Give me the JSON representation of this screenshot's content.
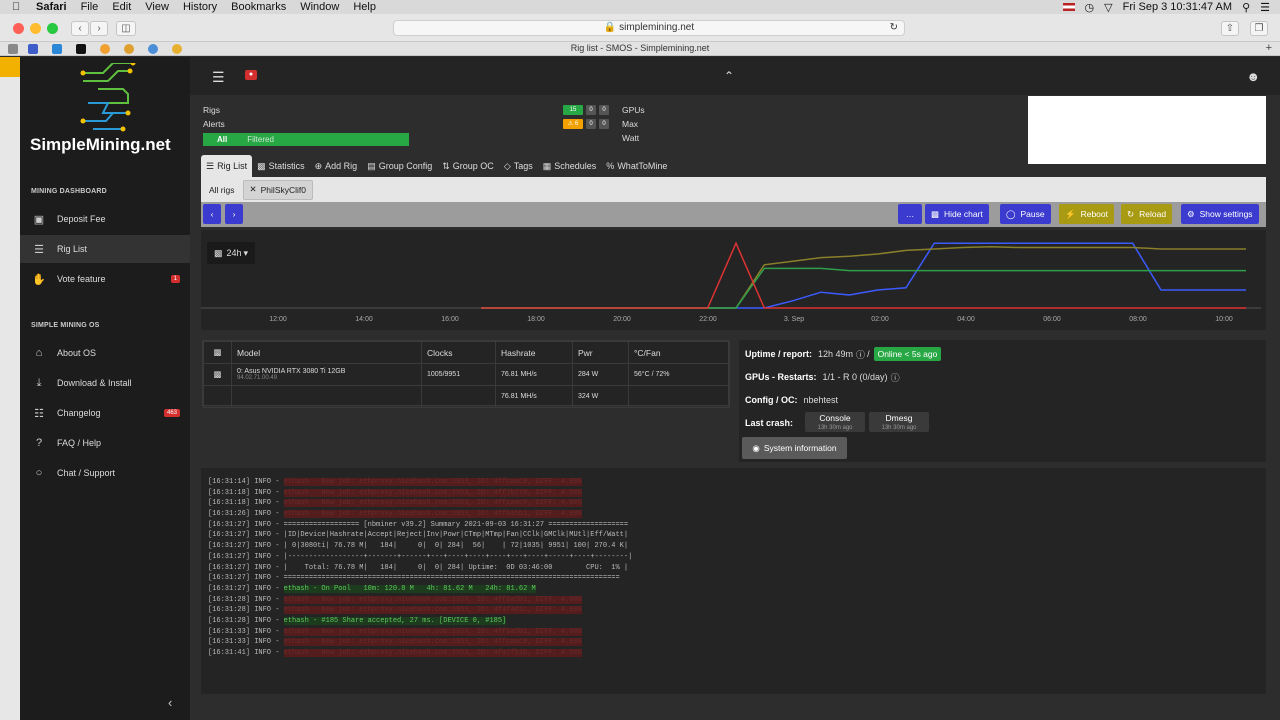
{
  "menubar": {
    "apple": "",
    "items": [
      "Safari",
      "File",
      "Edit",
      "View",
      "History",
      "Bookmarks",
      "Window",
      "Help"
    ],
    "clock": "Fri Sep 3  10:31:47 AM"
  },
  "browser": {
    "url": "simplemining.net",
    "tab_title": "Rig list - SMOS - Simplemining.net"
  },
  "sidebar": {
    "logo_text": "SimpleMining.net",
    "section1": "MINING DASHBOARD",
    "items1": [
      {
        "label": "Deposit Fee"
      },
      {
        "label": "Rig List"
      },
      {
        "label": "Vote feature",
        "badge": "1"
      }
    ],
    "section2": "SIMPLE MINING OS",
    "items2": [
      {
        "label": "About OS"
      },
      {
        "label": "Download & Install"
      },
      {
        "label": "Changelog",
        "badge": "463"
      },
      {
        "label": "FAQ / Help"
      },
      {
        "label": "Chat / Support"
      }
    ]
  },
  "stats": {
    "rigs_label": "Rigs",
    "alerts_label": "Alerts",
    "rigs_counts": [
      "15",
      "0",
      "0"
    ],
    "alerts_counts": [
      "⚠ 6",
      "0",
      "0"
    ],
    "filter_all": "All",
    "filter_filtered": "Filtered",
    "gpus_label": "GPUs",
    "max_label": "Max",
    "watt_label": "Watt"
  },
  "tabs": [
    "Rig List",
    "Statistics",
    "Add Rig",
    "Group Config",
    "Group OC",
    "Tags",
    "Schedules",
    "WhatToMine"
  ],
  "subtabs": [
    "All rigs",
    "PhilSkyClif0"
  ],
  "actions": {
    "more": "…",
    "hide_chart": "Hide chart",
    "pause": "Pause",
    "reboot": "Reboot",
    "reload": "Reload",
    "show_settings": "Show settings"
  },
  "chart_data": {
    "type": "line",
    "range_button": "24h",
    "x_ticks": [
      "12:00",
      "14:00",
      "16:00",
      "18:00",
      "20:00",
      "22:00",
      "3. Sep",
      "02:00",
      "04:00",
      "06:00",
      "08:00",
      "10:00"
    ],
    "series": [
      {
        "color": "#3b5bff",
        "values": [
          0,
          0,
          0,
          0,
          0,
          0,
          0,
          0,
          0,
          0,
          0,
          0.1,
          0.22,
          0.18,
          0.25,
          0.28,
          0.9,
          0.9,
          0.9,
          0.9,
          0.9,
          0.9,
          0.9,
          0.9,
          0.25,
          0.25,
          0.25,
          0.25
        ]
      },
      {
        "color": "#8a7f2a",
        "values": [
          0,
          0,
          0,
          0,
          0,
          0,
          0,
          0,
          0,
          0,
          0.6,
          0.65,
          0.7,
          0.72,
          0.75,
          0.8,
          0.82,
          0.84,
          0.85,
          0.84,
          0.84,
          0.84,
          0.84,
          0.84,
          0.82,
          0.82,
          0.82,
          0.82
        ]
      },
      {
        "color": "#2e9e4a",
        "values": [
          0,
          0,
          0,
          0,
          0,
          0,
          0,
          0,
          0,
          0,
          0.55,
          0.55,
          0.55,
          0.52,
          0.52,
          0.52,
          0.52,
          0.52,
          0.52,
          0.52,
          0.52,
          0.52,
          0.52,
          0.52,
          0.52,
          0.52,
          0.52,
          0.52
        ]
      },
      {
        "color": "#d33",
        "values": [
          0,
          0,
          0,
          0,
          0,
          0,
          0,
          0,
          0,
          0.9,
          0,
          0,
          0,
          0,
          0,
          0,
          0,
          0,
          0,
          0,
          0,
          0,
          0,
          0,
          0,
          0,
          0,
          0
        ]
      }
    ]
  },
  "gpu_table": {
    "headers": [
      "Model",
      "Clocks",
      "Hashrate",
      "Pwr",
      "°C/Fan"
    ],
    "row": {
      "model": "0: Asus NVIDIA RTX 3080 Ti 12GB",
      "bios": "94.02.71.00.49",
      "clocks": "1005/9951",
      "hashrate": "76.81 MH/s",
      "pwr": "284 W",
      "temp": "56°C / 72%"
    },
    "total": {
      "hashrate": "76.81 MH/s",
      "pwr": "324 W"
    }
  },
  "info": {
    "uptime_label": "Uptime / report:",
    "uptime_value": "12h 49m",
    "online": "Online < 5s ago",
    "restarts_label": "GPUs - Restarts:",
    "restarts_value": "1/1 - R 0 (0/day)",
    "config_label": "Config / OC:",
    "config_value": "nbehtest",
    "crash_label": "Last crash:",
    "console_btn": "Console",
    "console_sub": "13h 30m ago",
    "dmesg_btn": "Dmesg",
    "dmesg_sub": "13h 30m ago",
    "sysinfo_btn": "System information"
  },
  "console": [
    {
      "t": "[16:31:14] INFO - ",
      "h": "ethash - New job: ethproxy.nicehash.com:3353, ID: 4ffcaac0, DIFF: 4.00G",
      "k": "hl"
    },
    {
      "t": "[16:31:18] INFO - ",
      "h": "ethash - New job: ethproxy.nicehash.com:3353, ID: 4ff7b770, DIFF: 4.00G",
      "k": "hl"
    },
    {
      "t": "[16:31:18] INFO - ",
      "h": "ethash - New job: ethproxy.nicehash.com:3353, ID: 4ffcaac0, DIFF: 4.00G",
      "k": "hl"
    },
    {
      "t": "[16:31:26] INFO - ",
      "h": "ethash - New job: ethproxy.nicehash.com:3353, ID: 4ff6a5b1, DIFF: 4.00G",
      "k": "hl"
    },
    {
      "t": "[16:31:27] INFO - ================== [nbminer v39.2] Summary 2021-09-03 16:31:27 ===================",
      "h": "",
      "k": ""
    },
    {
      "t": "[16:31:27] INFO - |ID|Device|Hashrate|Accept|Reject|Inv|Powr|CTmp|MTmp|Fan|CClk|GMClk|MUtl|Eff/Watt|",
      "h": "",
      "k": ""
    },
    {
      "t": "[16:31:27] INFO - | 0|3080ti| 76.78 M|   184|     0|  0| 284|  56|    | 72|1035| 9951| 100| 270.4 K|",
      "h": "",
      "k": ""
    },
    {
      "t": "[16:31:27] INFO - |------------------+-------+------+---+----+----+----+---+----+-----+----+--------|",
      "h": "",
      "k": ""
    },
    {
      "t": "[16:31:27] INFO - |    Total: 76.78 M|   184|     0|  0| 284| Uptime:  0D 03:46:00        CPU:  1% |",
      "h": "",
      "k": ""
    },
    {
      "t": "[16:31:27] INFO - ================================================================================",
      "h": "",
      "k": ""
    },
    {
      "t": "[16:31:27] INFO - ",
      "h": "ethash - On Pool   10m: 120.8 M   4h: 81.62 M   24h: 81.62 M",
      "k": "hg"
    },
    {
      "t": "[16:31:28] INFO - ",
      "h": "ethash - New job: ethproxy.nicehash.com:3353, ID: 4ff6a5b1, DIFF: 4.00G",
      "k": "hl"
    },
    {
      "t": "[16:31:28] INFO - ",
      "h": "ethash - New job: ethproxy.nicehash.com:3353, ID: 4f4f4d1c, DIFF: 4.00G",
      "k": "hl"
    },
    {
      "t": "[16:31:28] INFO - ",
      "h": "ethash - #185 Share accepted, 27 ms. [DEVICE 0, #185]",
      "k": "hg"
    },
    {
      "t": "[16:31:33] INFO - ",
      "h": "ethash - New job: ethproxy.nicehash.com:3353, ID: 4ff6a5b1, DIFF: 4.00G",
      "k": "hl"
    },
    {
      "t": "[16:31:33] INFO - ",
      "h": "ethash - New job: ethproxy.nicehash.com:3353, ID: 4ffcaac0, DIFF: 4.00G",
      "k": "hl"
    },
    {
      "t": "[16:31:41] INFO - ",
      "h": "ethash - New job: ethproxy.nicehash.com:3353, ID: 4fa7fb1b, DIFF: 4.00G",
      "k": "hl"
    }
  ]
}
